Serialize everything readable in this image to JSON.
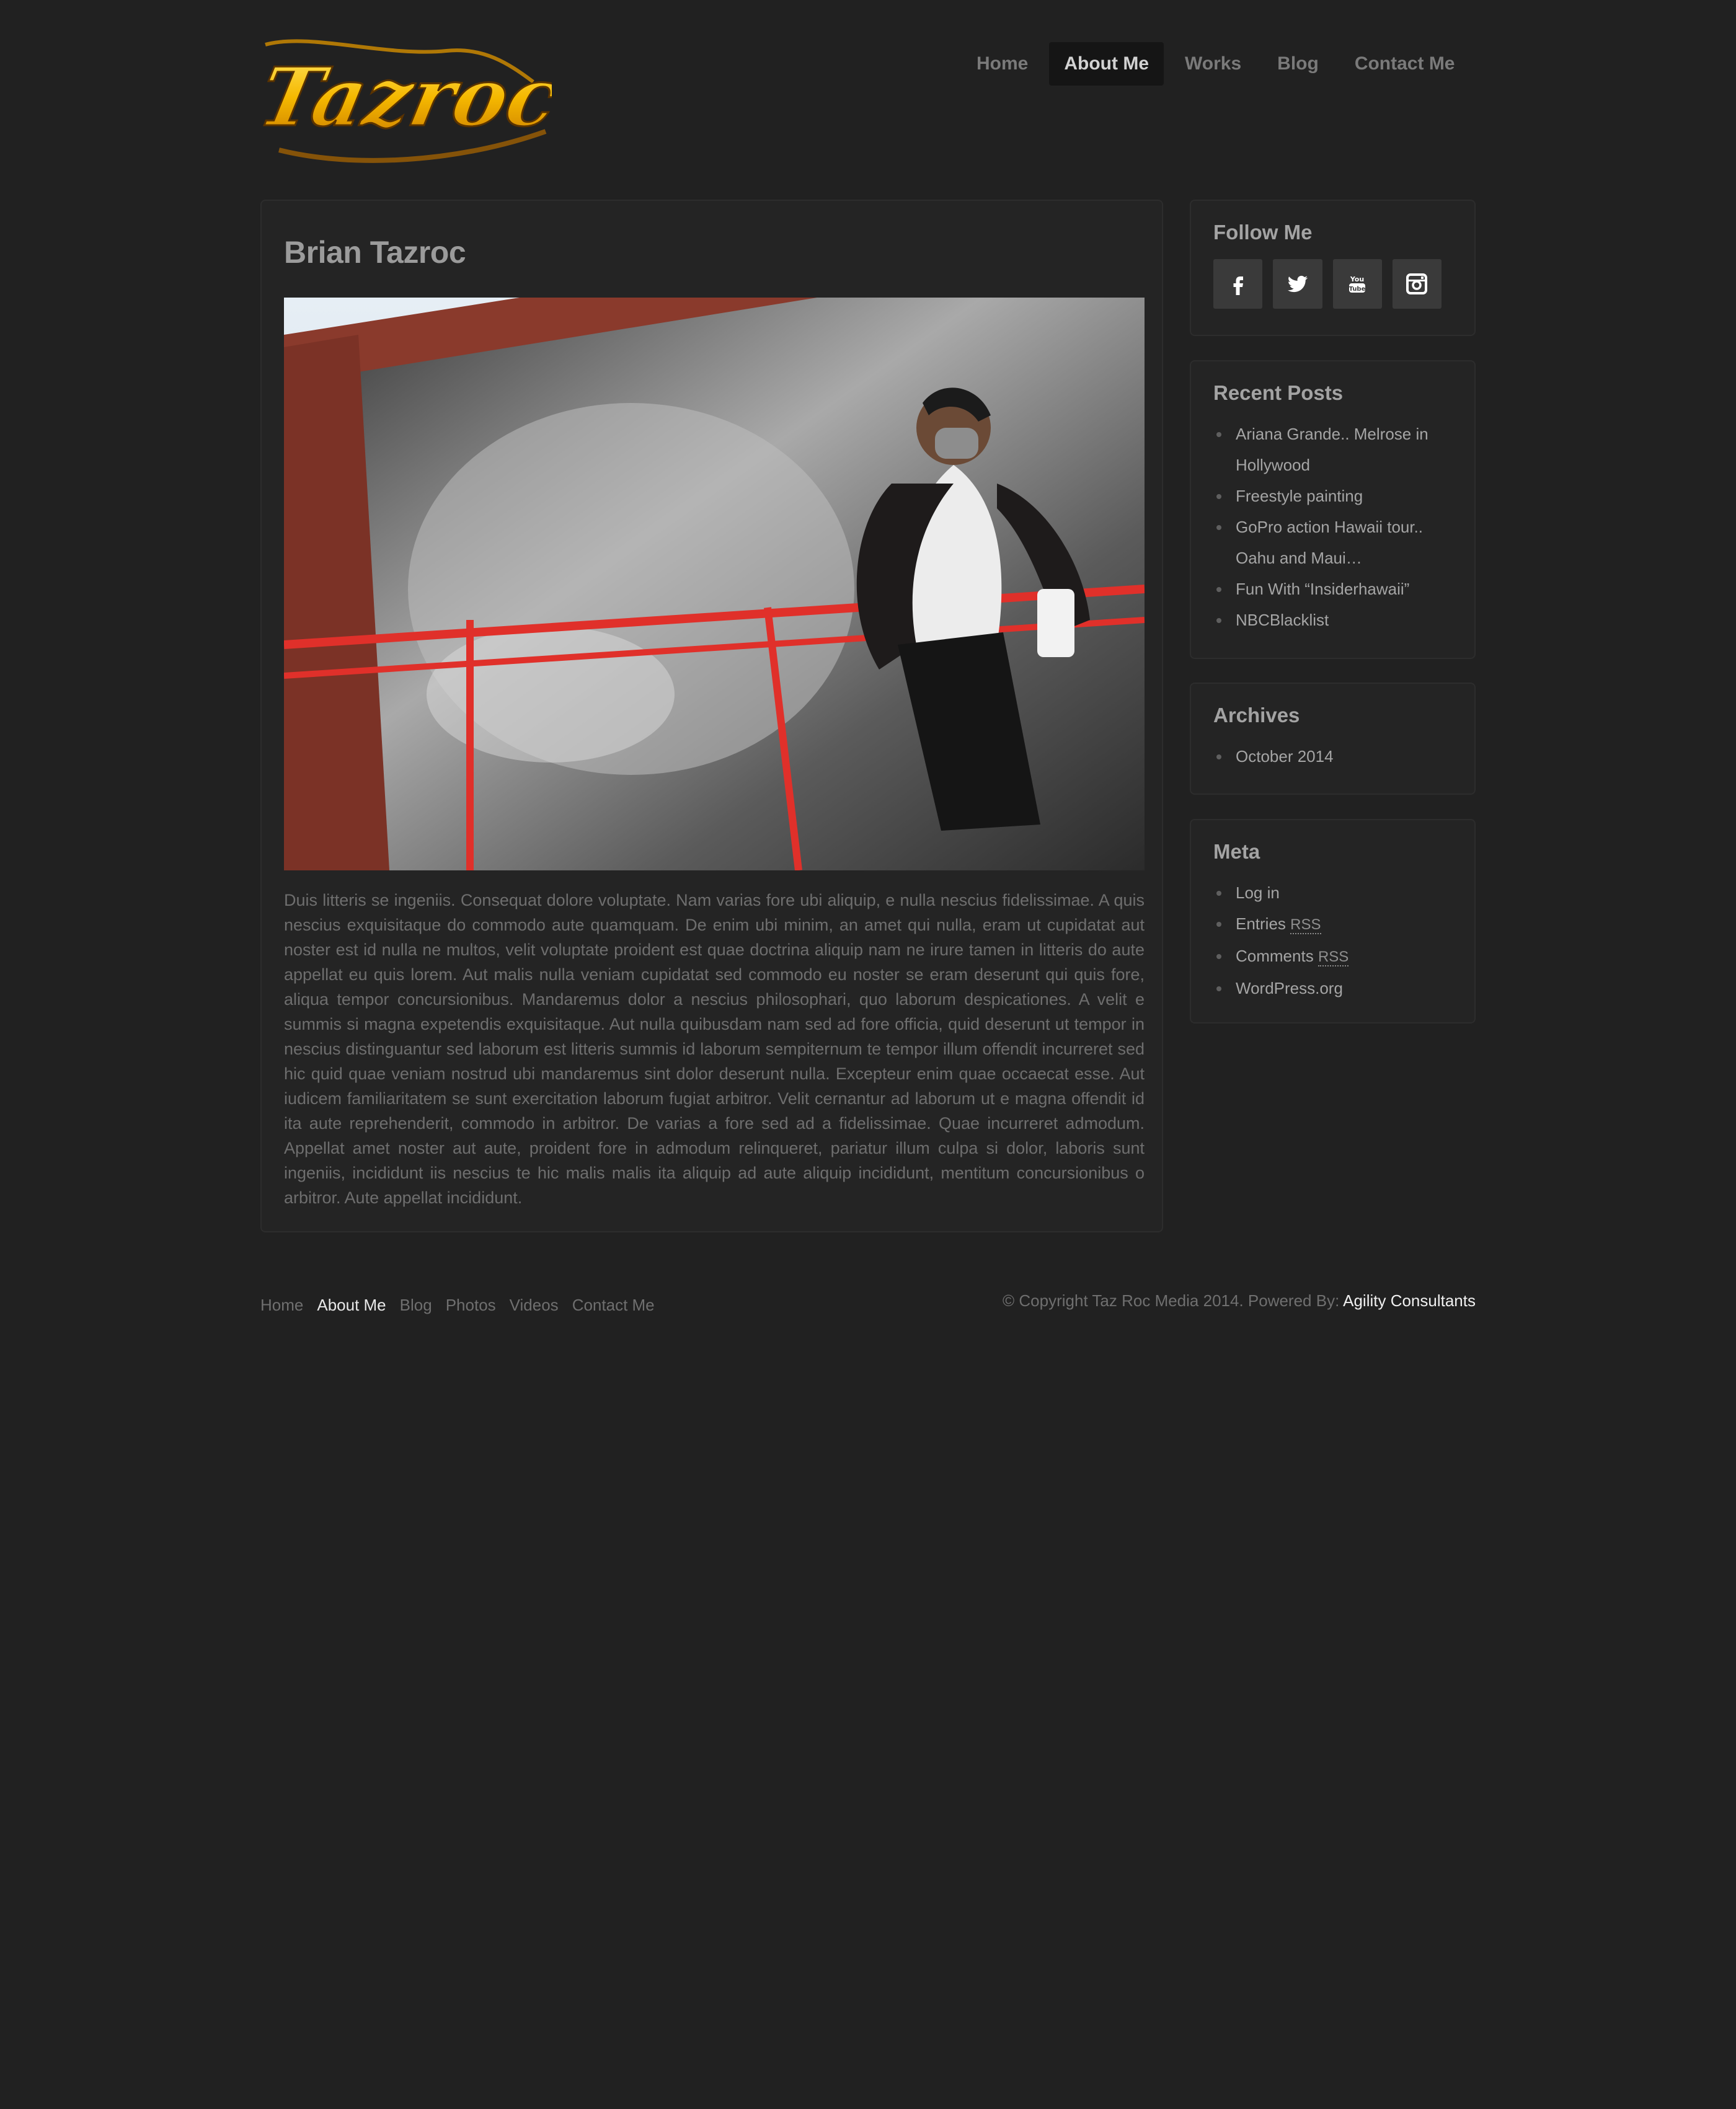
{
  "logo": {
    "text": "Tazroc"
  },
  "nav": {
    "items": [
      {
        "label": "Home",
        "active": false
      },
      {
        "label": "About Me",
        "active": true
      },
      {
        "label": "Works",
        "active": false
      },
      {
        "label": "Blog",
        "active": false
      },
      {
        "label": "Contact Me",
        "active": false
      }
    ]
  },
  "page": {
    "title": "Brian Tazroc",
    "body": "Duis litteris se ingeniis. Consequat dolore voluptate. Nam varias fore ubi aliquip, e nulla nescius fidelissimae. A quis nescius exquisitaque do commodo aute quamquam. De enim ubi minim, an amet qui nulla, eram ut cupidatat aut noster est id nulla ne multos, velit voluptate proident est quae doctrina aliquip nam ne irure tamen in litteris do aute appellat eu quis lorem. Aut malis nulla veniam cupidatat sed commodo eu noster se eram deserunt qui quis fore, aliqua tempor concursionibus. Mandaremus dolor a nescius philosophari, quo laborum despicationes. A velit e summis si magna expetendis exquisitaque. Aut nulla quibusdam nam sed ad fore officia, quid deserunt ut tempor in nescius distinguantur sed laborum est litteris summis id laborum sempiternum te tempor illum offendit incurreret sed hic quid quae veniam nostrud ubi mandaremus sint dolor deserunt nulla. Excepteur enim quae occaecat esse. Aut iudicem familiaritatem se sunt exercitation laborum fugiat arbitror. Velit cernantur ad laborum ut e magna offendit id ita aute reprehenderit, commodo in arbitror. De varias a fore sed ad a fidelissimae. Quae incurreret admodum. Appellat amet noster aut aute, proident fore in admodum relinqueret, pariatur illum culpa si dolor, laboris sunt ingeniis, incididunt iis nescius te hic malis malis ita aliquip ad aute aliquip incididunt, mentitum concursionibus o arbitror. Aute appellat incididunt."
  },
  "sidebar": {
    "follow": {
      "title": "Follow Me",
      "icons": [
        "facebook-icon",
        "twitter-icon",
        "youtube-icon",
        "instagram-icon"
      ]
    },
    "recent_posts": {
      "title": "Recent Posts",
      "items": [
        "Ariana Grande.. Melrose in Hollywood",
        "Freestyle painting",
        "GoPro action Hawaii tour.. Oahu and Maui…",
        "Fun With “Insiderhawaii”",
        "NBCBlacklist"
      ]
    },
    "archives": {
      "title": "Archives",
      "items": [
        "October 2014"
      ]
    },
    "meta": {
      "title": "Meta",
      "items": [
        {
          "label": "Log in"
        },
        {
          "label": "Entries",
          "suffix": "RSS"
        },
        {
          "label": "Comments",
          "suffix": "RSS"
        },
        {
          "label": "WordPress.org"
        }
      ]
    }
  },
  "footer": {
    "nav": [
      {
        "label": "Home",
        "active": false
      },
      {
        "label": "About Me",
        "active": true
      },
      {
        "label": "Blog",
        "active": false
      },
      {
        "label": "Photos",
        "active": false
      },
      {
        "label": "Videos",
        "active": false
      },
      {
        "label": "Contact Me",
        "active": false
      }
    ],
    "copyright": "© Copyright Taz Roc Media 2014. Powered By:",
    "powered_by": "Agility Consultants"
  },
  "colors": {
    "background": "#212121",
    "panel": "#242424",
    "logo_gold": "#f5b800"
  }
}
